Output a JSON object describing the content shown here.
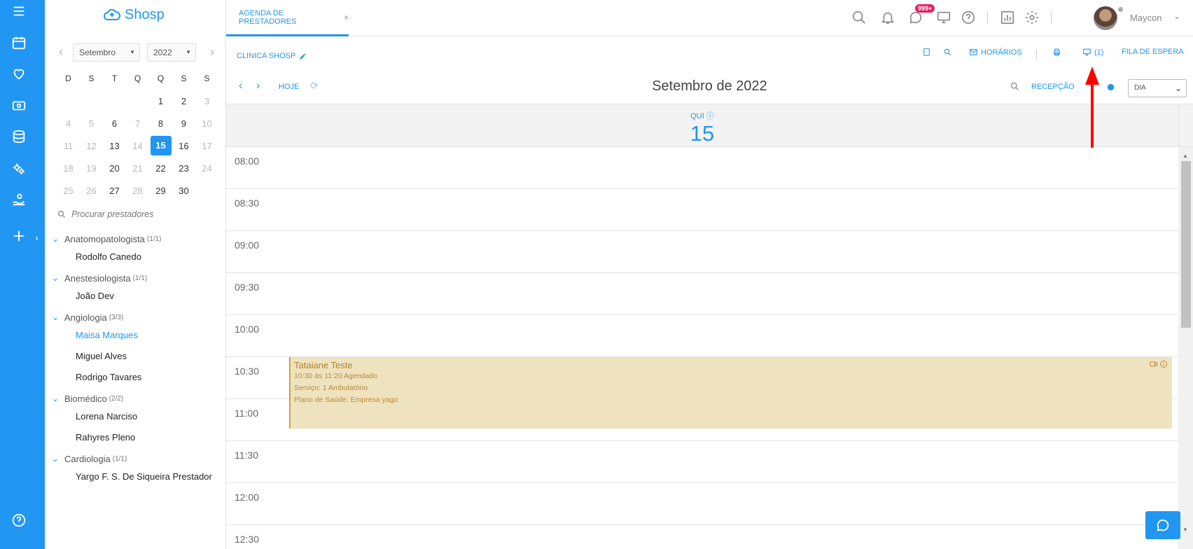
{
  "app": {
    "logo_text": "Shosp"
  },
  "rail": {
    "icons": [
      "menu-icon",
      "calendar-icon",
      "heart-icon",
      "cash-icon",
      "database-icon",
      "gears-icon",
      "hand-money-icon",
      "plus-icon",
      "help-icon"
    ],
    "color": "#2196f3"
  },
  "minical": {
    "month": "Setembro",
    "year": "2022",
    "weekdays": [
      "D",
      "S",
      "T",
      "Q",
      "Q",
      "S",
      "S"
    ],
    "weeks": [
      [
        "",
        "",
        "",
        "",
        "1",
        "2",
        "3"
      ],
      [
        "4",
        "5",
        "6",
        "7",
        "8",
        "9",
        "10"
      ],
      [
        "11",
        "12",
        "13",
        "14",
        "15",
        "16",
        "17"
      ],
      [
        "18",
        "19",
        "20",
        "21",
        "22",
        "23",
        "24"
      ],
      [
        "25",
        "26",
        "27",
        "28",
        "29",
        "30",
        ""
      ]
    ],
    "selected": "15"
  },
  "search": {
    "placeholder": "Procurar prestadores"
  },
  "groups": [
    {
      "name": "Anatomopatologista",
      "count": "(1/1)",
      "providers": [
        "Rodolfo Canedo"
      ]
    },
    {
      "name": "Anestesiologista",
      "count": "(1/1)",
      "providers": [
        "João Dev"
      ]
    },
    {
      "name": "Angiologia",
      "count": "(3/3)",
      "providers": [
        "Maisa Marques",
        "Miguel Alves",
        "Rodrigo Tavares"
      ]
    },
    {
      "name": "Biomédico",
      "count": "(2/2)",
      "providers": [
        "Lorena Narciso",
        "Rahyres Pleno"
      ]
    },
    {
      "name": "Cardiologia",
      "count": "(1/1)",
      "providers": [
        "Yargo F. S. De Siqueira Prestador"
      ]
    }
  ],
  "active_provider": "Maisa Marques",
  "topbar": {
    "tab_label": "AGENDA DE PRESTADORES",
    "tab_close": "×",
    "messages_badge": "999+",
    "user_name": "Maycon"
  },
  "bar2": {
    "clinic": "CLINICA SHOSP",
    "horarios": "HORÁRIOS",
    "queue_count": "(1)",
    "fila": "FILA DE ESPERA"
  },
  "bar3": {
    "today": "HOJE",
    "title": "Setembro de 2022",
    "reception": "RECEPÇÃO",
    "view": "DIA"
  },
  "day": {
    "name": "QUI",
    "number": "15"
  },
  "times": [
    "08:00",
    "08:30",
    "09:00",
    "09:30",
    "10:00",
    "10:30",
    "11:00",
    "11:30",
    "12:00",
    "12:30"
  ],
  "event": {
    "name": "Tataiane Teste",
    "line1": "10:30 às 11:20 Agendado",
    "line2": "Serviço: 1 Ambulatório",
    "line3": "Plano de Saúde: Empresa yago"
  },
  "colors": {
    "accent": "#2196f3",
    "event_bg": "#efe3bf",
    "badge": "#e91e63",
    "annotation_arrow": "#ff0000"
  }
}
